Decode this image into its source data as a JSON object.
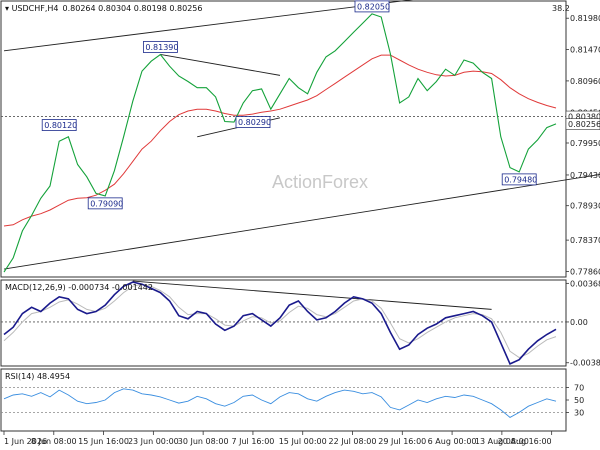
{
  "header": {
    "symbol": "USDCHF,H4",
    "ohlc": "0.80264 0.80304 0.80198 0.80256",
    "top_right": "38.2",
    "watermark": "ActionForex"
  },
  "chart_data": [
    {
      "type": "line",
      "panel": "price",
      "ylim": [
        0.7777,
        0.8226
      ],
      "yticks": [
        "0.81980",
        "0.81470",
        "0.80960",
        "0.80450",
        "0.79950",
        "0.79430",
        "0.78930",
        "0.78370",
        "0.77860"
      ],
      "current_price": "0.80256",
      "dotted_level": "0.80380",
      "xticks": [
        "1 Jun 2026",
        "8 Jun 08:00",
        "15 Jun 16:00",
        "23 Jun 00:00",
        "30 Jun 08:00",
        "7 Jul 16:00",
        "15 Jul 00:00",
        "22 Jul 08:00",
        "29 Jul 16:00",
        "6 Aug 00:00",
        "13 Aug 08:00",
        "20 Aug 16:00"
      ],
      "series": [
        {
          "values": [
            0.7785,
            0.7808,
            0.7852,
            0.7877,
            0.7905,
            0.7925,
            0.7998,
            0.8005,
            0.796,
            0.794,
            0.7913,
            0.7909,
            0.795,
            0.8005,
            0.8063,
            0.8112,
            0.8128,
            0.8139,
            0.812,
            0.8104,
            0.8095,
            0.8085,
            0.8085,
            0.807,
            0.803,
            0.8029,
            0.806,
            0.808,
            0.8083,
            0.805,
            0.8075,
            0.81,
            0.8085,
            0.8075,
            0.811,
            0.8135,
            0.8145,
            0.816,
            0.8175,
            0.819,
            0.8205,
            0.82,
            0.814,
            0.806,
            0.807,
            0.81,
            0.808,
            0.8095,
            0.8115,
            0.8105,
            0.813,
            0.8125,
            0.811,
            0.81,
            0.8005,
            0.7955,
            0.7948,
            0.7985,
            0.8,
            0.802,
            0.8026
          ]
        },
        {
          "name": "",
          "values": [
            0.786,
            0.7862,
            0.787,
            0.7876,
            0.788,
            0.7886,
            0.7894,
            0.7902,
            0.7905,
            0.7906,
            0.791,
            0.7918,
            0.7928,
            0.7945,
            0.7965,
            0.7985,
            0.7998,
            0.8015,
            0.803,
            0.8041,
            0.8047,
            0.805,
            0.805,
            0.8047,
            0.8043,
            0.804,
            0.804,
            0.8042,
            0.8045,
            0.8047,
            0.805,
            0.8055,
            0.806,
            0.8065,
            0.8072,
            0.8082,
            0.8092,
            0.8102,
            0.8112,
            0.8122,
            0.8132,
            0.8138,
            0.8138,
            0.813,
            0.8122,
            0.8115,
            0.811,
            0.8106,
            0.8104,
            0.8105,
            0.811,
            0.8112,
            0.8111,
            0.8108,
            0.8098,
            0.8085,
            0.8075,
            0.8067,
            0.8061,
            0.8056,
            0.8052
          ]
        }
      ],
      "annotations": [
        {
          "label": "0.80120",
          "x": 6,
          "y": 0.8012
        },
        {
          "label": "0.81390",
          "x": 17,
          "y": 0.8139
        },
        {
          "label": "0.80290",
          "x": 25,
          "y": 0.8029
        },
        {
          "label": "0.82050",
          "x": 40,
          "y": 0.8205
        },
        {
          "label": "0.79090",
          "x": 11,
          "y": 0.7909
        },
        {
          "label": "0.79480",
          "x": 56,
          "y": 0.7948
        }
      ],
      "trendlines": [
        {
          "x": [
            0,
            48
          ],
          "y": [
            0.8145,
            0.8235
          ]
        },
        {
          "x": [
            0,
            80
          ],
          "y": [
            0.779,
            0.798
          ]
        },
        {
          "x": [
            17,
            30
          ],
          "y": [
            0.8139,
            0.8105
          ]
        },
        {
          "x": [
            21,
            30
          ],
          "y": [
            0.8005,
            0.8036
          ]
        }
      ]
    },
    {
      "type": "line",
      "panel": "macd",
      "title": "MACD(12,26,9) -0.000734 -0.001442",
      "ylim": [
        -0.0042,
        0.004
      ],
      "yticks": [
        "0.00368",
        "0.00",
        "-0.00389"
      ],
      "series": [
        {
          "values": [
            -0.0012,
            -0.0005,
            0.0008,
            0.0014,
            0.001,
            0.0018,
            0.0024,
            0.0022,
            0.0012,
            0.0008,
            0.001,
            0.0016,
            0.0026,
            0.0034,
            0.0038,
            0.0036,
            0.0032,
            0.0028,
            0.002,
            0.0006,
            0.0003,
            0.001,
            0.0008,
            -0.0002,
            -0.0008,
            -0.0004,
            0.0006,
            0.0008,
            0.0002,
            -0.0004,
            0.0004,
            0.0016,
            0.002,
            0.001,
            0.0002,
            0.0004,
            0.001,
            0.0018,
            0.0024,
            0.0022,
            0.0018,
            0.0008,
            -0.001,
            -0.0026,
            -0.0022,
            -0.0012,
            -0.0006,
            -0.0002,
            0.0004,
            0.0006,
            0.0008,
            0.001,
            0.0006,
            0.0,
            -0.002,
            -0.004,
            -0.0036,
            -0.0026,
            -0.0018,
            -0.0012,
            -0.0007
          ]
        },
        {
          "values": [
            -0.0018,
            -0.001,
            0.0,
            0.0008,
            0.001,
            0.0014,
            0.0019,
            0.0021,
            0.0017,
            0.0012,
            0.001,
            0.0013,
            0.002,
            0.0028,
            0.0034,
            0.0036,
            0.0034,
            0.003,
            0.0024,
            0.0014,
            0.0007,
            0.0008,
            0.0008,
            0.0003,
            -0.0003,
            -0.0004,
            0.0001,
            0.0005,
            0.0004,
            -0.0001,
            0.0001,
            0.0009,
            0.0015,
            0.0013,
            0.0007,
            0.0005,
            0.0008,
            0.0014,
            0.002,
            0.0022,
            0.002,
            0.0013,
            -0.0001,
            -0.0016,
            -0.002,
            -0.0016,
            -0.001,
            -0.0005,
            0.0,
            0.0004,
            0.0006,
            0.0008,
            0.0007,
            0.0003,
            -0.001,
            -0.0028,
            -0.0034,
            -0.003,
            -0.0023,
            -0.0017,
            -0.0014
          ]
        }
      ]
    },
    {
      "type": "line",
      "panel": "rsi",
      "title": "RSI(14) 48.4954",
      "ylim": [
        0,
        100
      ],
      "yticks": [
        "70",
        "50",
        "30"
      ],
      "series": [
        {
          "values": [
            52,
            58,
            60,
            56,
            62,
            55,
            66,
            58,
            48,
            44,
            46,
            50,
            62,
            68,
            66,
            60,
            58,
            55,
            50,
            45,
            48,
            56,
            52,
            44,
            40,
            46,
            56,
            58,
            50,
            44,
            55,
            62,
            60,
            52,
            48,
            56,
            62,
            66,
            64,
            60,
            62,
            55,
            38,
            34,
            42,
            50,
            46,
            52,
            56,
            54,
            58,
            56,
            50,
            44,
            34,
            22,
            30,
            40,
            46,
            52,
            48
          ]
        }
      ]
    }
  ]
}
